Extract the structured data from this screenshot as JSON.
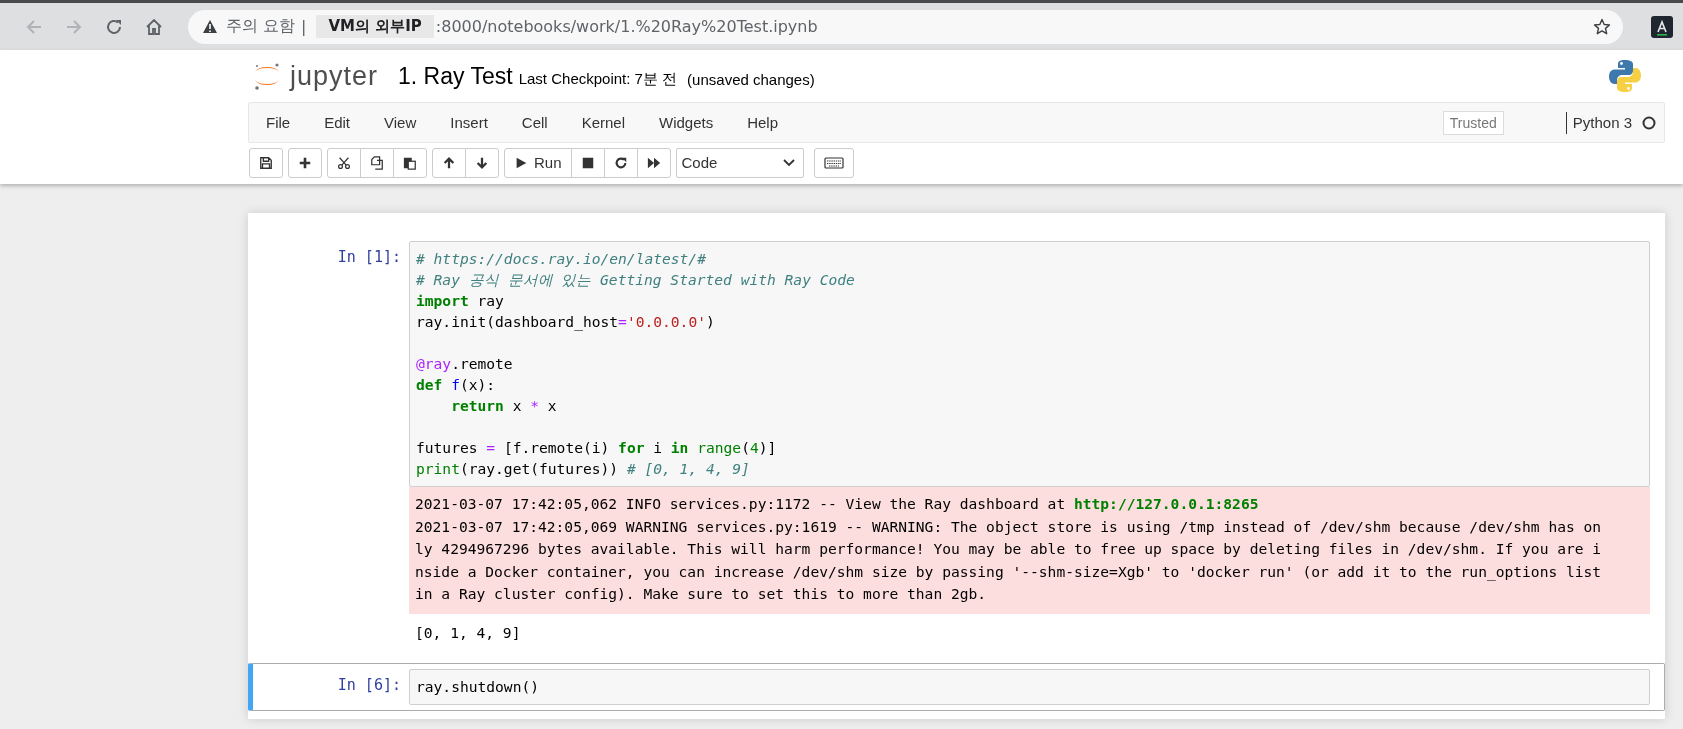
{
  "browser": {
    "security_label": "주의 요함",
    "separator": "|",
    "host_label": "VM의 외부IP",
    "url": ":8000/notebooks/work/1.%20Ray%20Test.ipynb"
  },
  "header": {
    "logo_text": "jupyter",
    "notebook_title": "1. Ray Test",
    "checkpoint": "Last Checkpoint: 7분 전",
    "save_status": "(unsaved changes)"
  },
  "menu": {
    "items": [
      "File",
      "Edit",
      "View",
      "Insert",
      "Cell",
      "Kernel",
      "Widgets",
      "Help"
    ],
    "trusted": "Trusted",
    "kernel_name": "Python 3",
    "kernel_busy": false
  },
  "toolbar": {
    "run_label": "Run",
    "cell_type": "Code"
  },
  "cells": [
    {
      "prompt": "In [1]:",
      "selected": false,
      "code": [
        {
          "kind": "text",
          "tokens": [
            {
              "kind": "comment",
              "text": "# https://docs.ray.io/en/latest/#"
            }
          ]
        },
        {
          "kind": "text",
          "tokens": [
            {
              "kind": "comment",
              "text": "# Ray 공식 문서에 있는 Getting Started with Ray Code"
            }
          ]
        },
        {
          "kind": "text",
          "tokens": [
            {
              "kind": "keyword",
              "text": "import"
            },
            {
              "kind": "plain",
              "text": " ray"
            }
          ]
        },
        {
          "kind": "text",
          "tokens": [
            {
              "kind": "plain",
              "text": "ray.init(dashboard_host"
            },
            {
              "kind": "operator",
              "text": "="
            },
            {
              "kind": "string",
              "text": "'0.0.0.0'"
            },
            {
              "kind": "plain",
              "text": ")"
            }
          ]
        },
        {
          "kind": "blank"
        },
        {
          "kind": "text",
          "tokens": [
            {
              "kind": "decorator",
              "text": "@ray"
            },
            {
              "kind": "plain",
              "text": ".remote"
            }
          ]
        },
        {
          "kind": "text",
          "tokens": [
            {
              "kind": "keyword",
              "text": "def"
            },
            {
              "kind": "function",
              "text": " f"
            },
            {
              "kind": "plain",
              "text": "(x):"
            }
          ]
        },
        {
          "kind": "text",
          "tokens": [
            {
              "kind": "keyword",
              "text": "    return"
            },
            {
              "kind": "plain",
              "text": " x "
            },
            {
              "kind": "operator",
              "text": "*"
            },
            {
              "kind": "plain",
              "text": " x"
            }
          ]
        },
        {
          "kind": "blank"
        },
        {
          "kind": "text",
          "tokens": [
            {
              "kind": "plain",
              "text": "futures "
            },
            {
              "kind": "operator",
              "text": "="
            },
            {
              "kind": "plain",
              "text": " [f.remote(i) "
            },
            {
              "kind": "keyword",
              "text": "for"
            },
            {
              "kind": "plain",
              "text": " i "
            },
            {
              "kind": "keyword",
              "text": "in"
            },
            {
              "kind": "builtin",
              "text": " range"
            },
            {
              "kind": "plain",
              "text": "("
            },
            {
              "kind": "number",
              "text": "4"
            },
            {
              "kind": "plain",
              "text": ")]"
            }
          ]
        },
        {
          "kind": "text",
          "tokens": [
            {
              "kind": "builtin",
              "text": "print"
            },
            {
              "kind": "plain",
              "text": "(ray.get(futures)) "
            },
            {
              "kind": "comment",
              "text": "# [0, 1, 4, 9]"
            }
          ]
        }
      ],
      "outputs": [
        {
          "kind": "stderr",
          "lines": [
            {
              "kind": "text",
              "tokens": [
                {
                  "kind": "plain",
                  "text": "2021-03-07 17:42:05,062 INFO services.py:1172 -- View the Ray dashboard at "
                },
                {
                  "kind": "url",
                  "text": "http://127.0.0.1:8265"
                }
              ]
            },
            {
              "kind": "text",
              "tokens": [
                {
                  "kind": "plain",
                  "text": "2021-03-07 17:42:05,069 WARNING services.py:1619 -- WARNING: The object store is using /tmp instead of /dev/shm because /dev/shm has on"
                }
              ]
            },
            {
              "kind": "text",
              "tokens": [
                {
                  "kind": "plain",
                  "text": "ly 4294967296 bytes available. This will harm performance! You may be able to free up space by deleting files in /dev/shm. If you are i"
                }
              ]
            },
            {
              "kind": "text",
              "tokens": [
                {
                  "kind": "plain",
                  "text": "nside a Docker container, you can increase /dev/shm size by passing '--shm-size=Xgb' to 'docker run' (or add it to the run_options list"
                }
              ]
            },
            {
              "kind": "text",
              "tokens": [
                {
                  "kind": "plain",
                  "text": "in a Ray cluster config). Make sure to set this to more than 2gb."
                }
              ]
            }
          ]
        },
        {
          "kind": "stdout",
          "lines": [
            {
              "kind": "text",
              "tokens": [
                {
                  "kind": "plain",
                  "text": "[0, 1, 4, 9]"
                }
              ]
            }
          ]
        }
      ]
    },
    {
      "prompt": "In [6]:",
      "selected": true,
      "code": [
        {
          "kind": "text",
          "tokens": [
            {
              "kind": "plain",
              "text": "ray.shutdown()"
            }
          ]
        }
      ]
    }
  ]
}
